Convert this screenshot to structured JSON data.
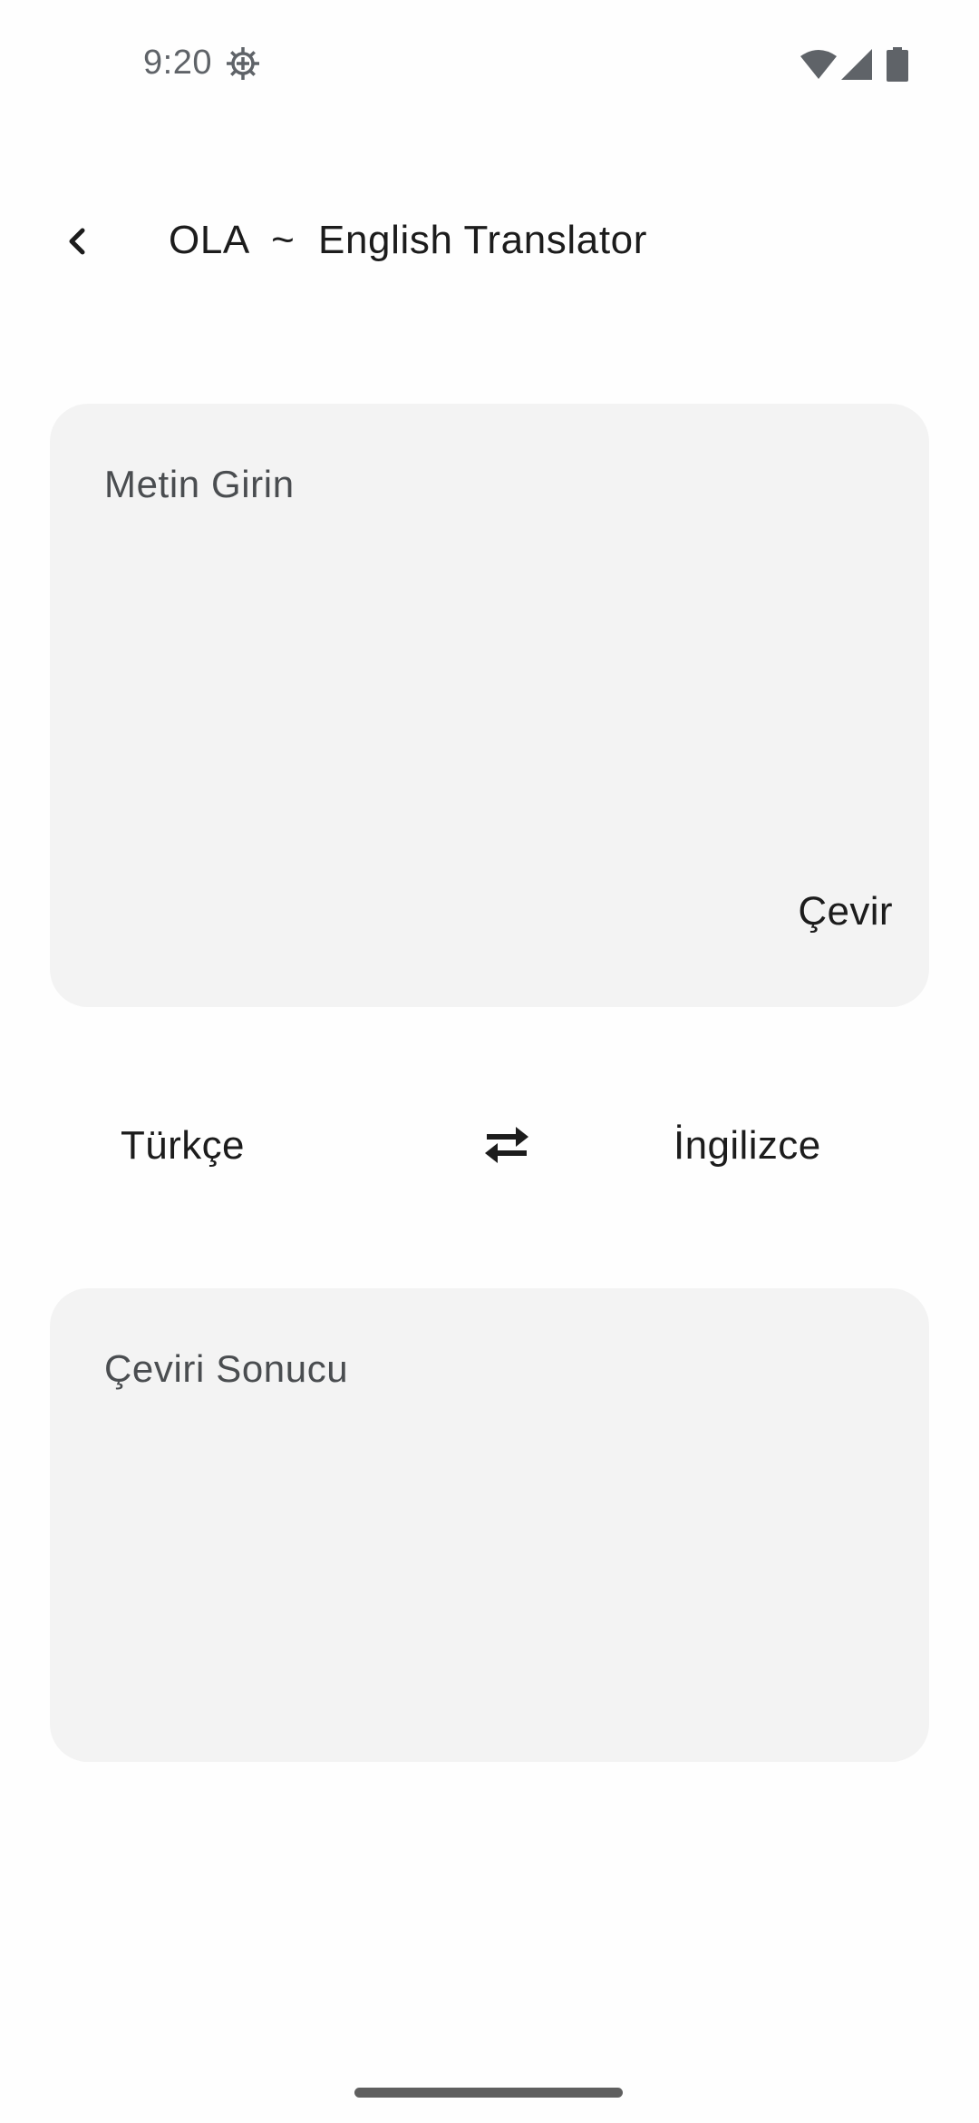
{
  "status_bar": {
    "time": "9:20",
    "icons": [
      "settings-gear-icon",
      "wifi-icon",
      "cellular-signal-icon",
      "battery-icon"
    ]
  },
  "app_bar": {
    "back_icon": "chevron-left-icon",
    "title": "OLA  ~  English Translator"
  },
  "input_card": {
    "placeholder": "Metin Girin",
    "value": "",
    "translate_label": "Çevir"
  },
  "language_row": {
    "source_language": "Türkçe",
    "swap_icon": "swap-horizontal-icon",
    "target_language": "İngilizce"
  },
  "result_card": {
    "placeholder": "Çeviri Sonucu"
  },
  "colors": {
    "background": "#fefefe",
    "card_background": "#f3f3f3",
    "text_primary": "#1c1c1c",
    "text_hint": "#4a4d50",
    "status_icons": "#5f6368"
  }
}
